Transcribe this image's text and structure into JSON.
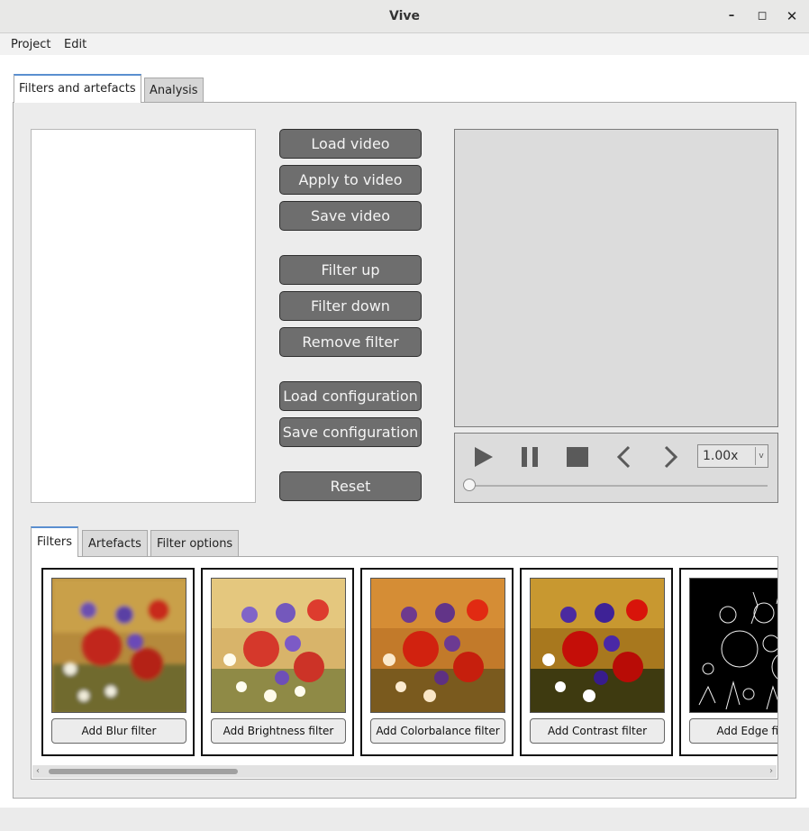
{
  "window": {
    "title": "Vive",
    "minimize": "–",
    "maximize": "◻",
    "close": "✕"
  },
  "menu": {
    "items": [
      "Project",
      "Edit"
    ]
  },
  "tabs": [
    {
      "label": "Filters and artefacts",
      "active": true
    },
    {
      "label": "Analysis",
      "active": false
    }
  ],
  "buttons": {
    "load_video": "Load video",
    "apply_video": "Apply to video",
    "save_video": "Save video",
    "filter_up": "Filter up",
    "filter_down": "Filter down",
    "remove_filter": "Remove filter",
    "load_config": "Load configuration",
    "save_config": "Save configuration",
    "reset": "Reset"
  },
  "player": {
    "icons": [
      "play-icon",
      "pause-icon",
      "stop-icon",
      "previous-icon",
      "next-icon"
    ],
    "speed": "1.00x",
    "progress": 0
  },
  "subtabs": [
    {
      "label": "Filters",
      "active": true
    },
    {
      "label": "Artefacts",
      "active": false
    },
    {
      "label": "Filter options",
      "active": false
    }
  ],
  "filter_cards": [
    {
      "label": "Add Blur filter",
      "style": "blur"
    },
    {
      "label": "Add Brightness filter",
      "style": "brightness"
    },
    {
      "label": "Add Colorbalance filter",
      "style": "colorbalance"
    },
    {
      "label": "Add Contrast filter",
      "style": "contrast"
    },
    {
      "label": "Add Edge filter",
      "style": "edge"
    }
  ],
  "colors": {
    "button_bg": "#6e6e6e",
    "tab_accent": "#5a8fd0",
    "panel_bg": "#ececec"
  }
}
